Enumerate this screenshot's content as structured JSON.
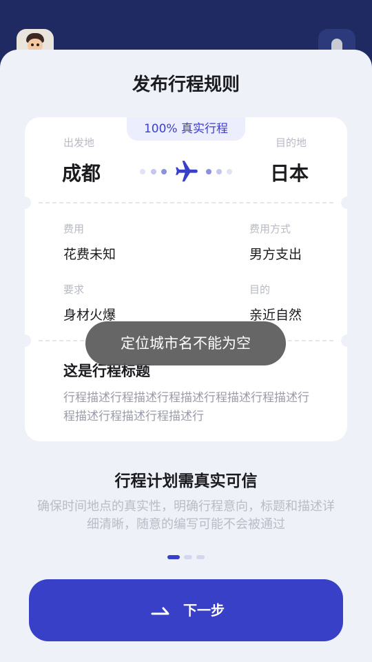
{
  "header": {
    "title": "发布行程规则"
  },
  "card": {
    "badge": "100% 真实行程",
    "origin_label": "出发地",
    "origin": "成都",
    "destination_label": "目的地",
    "destination": "日本",
    "fee_label": "费用",
    "fee_value": "花费未知",
    "payment_label": "费用方式",
    "payment_value": "男方支出",
    "requirement_label": "要求",
    "requirement_value": "身材火爆",
    "purpose_label": "目的",
    "purpose_value": "亲近自然",
    "trip_title": "这是行程标题",
    "trip_desc": "行程描述行程描述行程描述行程描述行程描述行程描述行程描述行程描述行"
  },
  "rule": {
    "heading": "行程计划需真实可信",
    "desc": "确保时间地点的真实性，明确行程意向，标题和描述详细清晰，随意的编写可能不会被通过"
  },
  "pager": {
    "count": 3,
    "active_index": 0
  },
  "next_button": {
    "label": "下一步"
  },
  "toast": {
    "message": "定位城市名不能为空"
  },
  "colors": {
    "accent": "#3840c8",
    "header_bg": "#1f2a63",
    "sheet_bg": "#eef1f7"
  },
  "icons": {
    "plane": "airplane-icon",
    "next": "arrow-icon"
  }
}
